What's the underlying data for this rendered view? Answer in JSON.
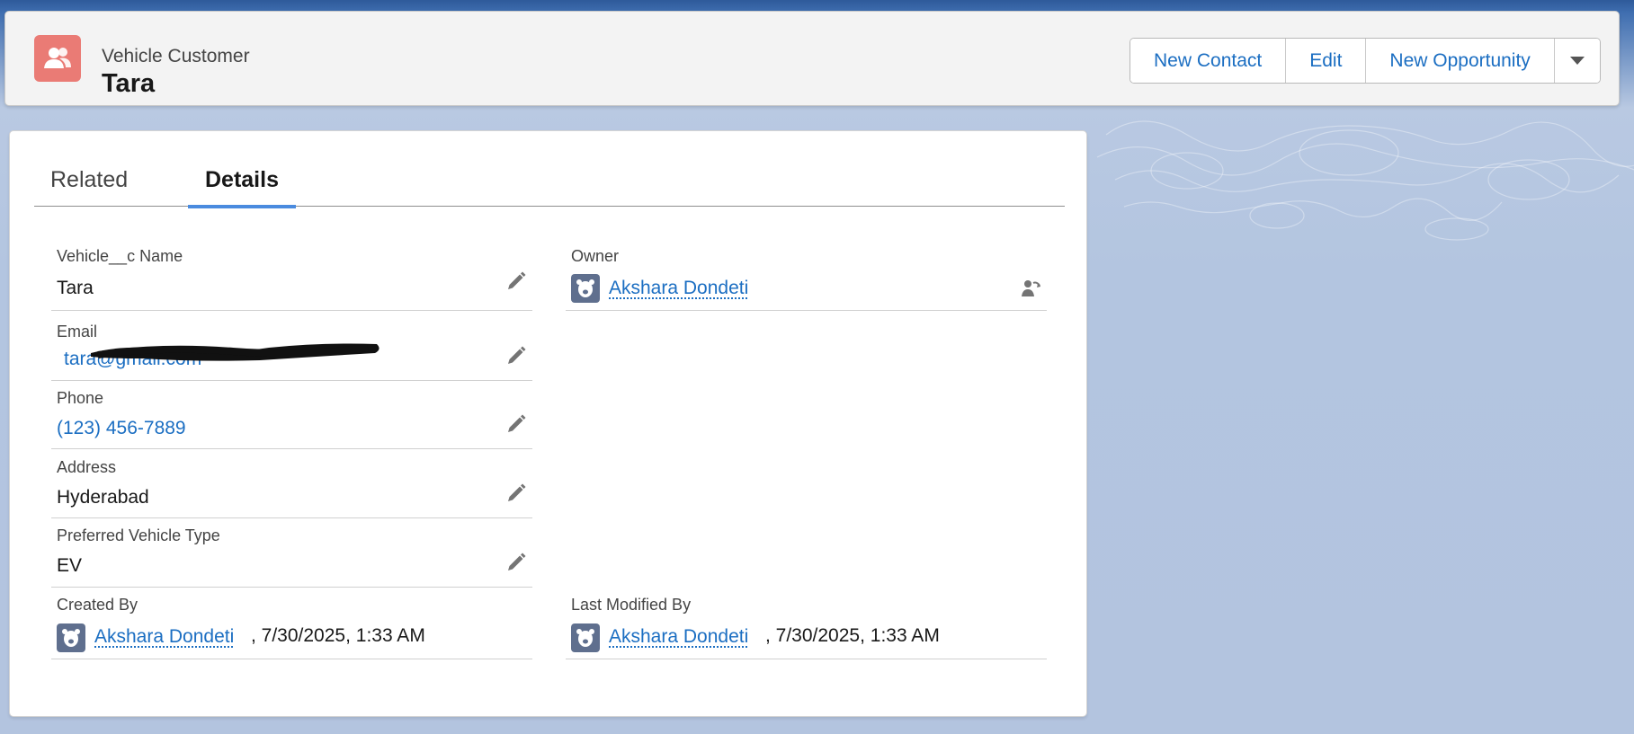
{
  "header": {
    "object_label": "Vehicle Customer",
    "record_title": "Tara",
    "icon": "contact-icon",
    "actions": [
      "New Contact",
      "Edit",
      "New Opportunity"
    ],
    "more_icon": "chevron-down-icon"
  },
  "tabs": [
    {
      "label": "Related",
      "active": false
    },
    {
      "label": "Details",
      "active": true
    }
  ],
  "fields": {
    "name": {
      "label": "Vehicle__c Name",
      "value": "Tara"
    },
    "owner": {
      "label": "Owner",
      "value": "Akshara Dondeti"
    },
    "email": {
      "label": "Email",
      "value": "tara@gmail.com"
    },
    "phone": {
      "label": "Phone",
      "value": "(123) 456-7889"
    },
    "address": {
      "label": "Address",
      "value": "Hyderabad"
    },
    "vehicle_type": {
      "label": "Preferred Vehicle Type",
      "value": "EV"
    },
    "created_by": {
      "label": "Created By",
      "user": "Akshara Dondeti",
      "timestamp": ", 7/30/2025, 1:33 AM"
    },
    "last_modified_by": {
      "label": "Last Modified By",
      "user": "Akshara Dondeti",
      "timestamp": ", 7/30/2025, 1:33 AM"
    }
  },
  "colors": {
    "accent": "#1b6ec2",
    "icon_bg": "#ea7b75",
    "tab_underline": "#4a8bdf"
  }
}
